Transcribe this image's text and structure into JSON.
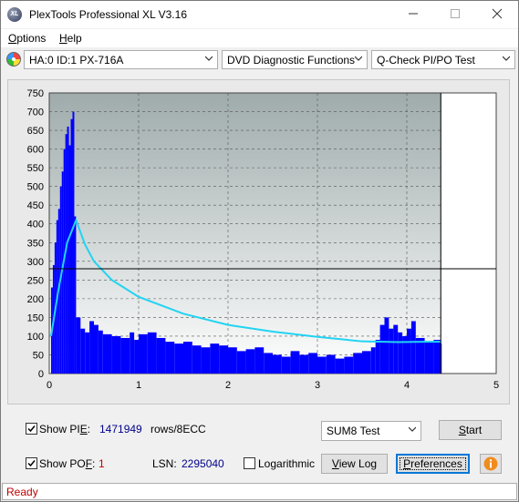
{
  "window": {
    "title": "PlexTools Professional XL V3.16",
    "app_icon": "XL",
    "controls": [
      "minimize-icon",
      "maximize-icon",
      "close-icon"
    ]
  },
  "menu": {
    "items": [
      {
        "label": "Options",
        "accel": "O",
        "rest": "ptions"
      },
      {
        "label": "Help",
        "accel": "H",
        "rest": "elp"
      }
    ]
  },
  "toolbar": {
    "drive": "HA:0 ID:1  PX-716A",
    "function": "DVD Diagnostic Functions",
    "test": "Q-Check PI/PO Test"
  },
  "chart_data": {
    "type": "line",
    "title": "",
    "xlabel": "",
    "ylabel": "",
    "xlim": [
      0,
      5
    ],
    "ylim": [
      0,
      750
    ],
    "x_ticks": [
      "0",
      "1",
      "2",
      "3",
      "4",
      "5"
    ],
    "y_ticks": [
      "0",
      "50",
      "100",
      "150",
      "200",
      "250",
      "300",
      "350",
      "400",
      "450",
      "500",
      "550",
      "600",
      "650",
      "700",
      "750"
    ],
    "grid": true,
    "reference_line_y": 280,
    "end_marker_x": 4.38,
    "series": [
      {
        "kind": "bars",
        "color": "#0000ff",
        "x": [
          0.02,
          0.04,
          0.06,
          0.08,
          0.1,
          0.12,
          0.14,
          0.16,
          0.18,
          0.2,
          0.22,
          0.24,
          0.26,
          0.28,
          0.3,
          0.35,
          0.4,
          0.45,
          0.5,
          0.55,
          0.6,
          0.7,
          0.8,
          0.9,
          0.95,
          1.0,
          1.1,
          1.2,
          1.3,
          1.4,
          1.5,
          1.6,
          1.7,
          1.8,
          1.9,
          2.0,
          2.1,
          2.2,
          2.3,
          2.4,
          2.5,
          2.6,
          2.7,
          2.8,
          2.9,
          3.0,
          3.1,
          3.2,
          3.3,
          3.4,
          3.5,
          3.6,
          3.65,
          3.7,
          3.75,
          3.8,
          3.85,
          3.9,
          3.95,
          4.0,
          4.05,
          4.1,
          4.2,
          4.3,
          4.38
        ],
        "values": [
          230,
          290,
          350,
          410,
          440,
          500,
          540,
          600,
          640,
          660,
          610,
          680,
          700,
          420,
          150,
          120,
          110,
          140,
          130,
          115,
          105,
          100,
          95,
          110,
          90,
          105,
          110,
          95,
          85,
          80,
          85,
          75,
          70,
          80,
          75,
          70,
          60,
          65,
          70,
          55,
          50,
          45,
          60,
          50,
          55,
          45,
          50,
          40,
          45,
          55,
          60,
          70,
          90,
          130,
          150,
          120,
          130,
          110,
          100,
          120,
          140,
          95,
          85,
          90,
          80
        ]
      },
      {
        "kind": "line",
        "color": "#21d4f2",
        "x": [
          0.02,
          0.1,
          0.2,
          0.3,
          0.4,
          0.5,
          0.7,
          1.0,
          1.5,
          2.0,
          2.5,
          3.0,
          3.5,
          3.9,
          4.2,
          4.38
        ],
        "values": [
          100,
          220,
          350,
          410,
          345,
          300,
          250,
          205,
          160,
          130,
          112,
          98,
          86,
          84,
          85,
          85
        ]
      }
    ]
  },
  "controls": {
    "show_pie": {
      "checked": true,
      "label_prefix": "Show PI",
      "accel": "E",
      "suffix": ":",
      "value": "1471949",
      "unit": "rows/8ECC"
    },
    "show_pof": {
      "checked": true,
      "label_prefix": "Show PO",
      "accel": "F",
      "suffix": ":",
      "value": "1"
    },
    "lsn": {
      "label": "LSN:",
      "value": "2295040"
    },
    "logarithmic": {
      "checked": false,
      "label": "Logarithmic"
    },
    "sum8": {
      "value": "SUM8 Test"
    },
    "start": {
      "accel": "S",
      "rest": "tart"
    },
    "view_log": {
      "accel": "V",
      "rest": "iew Log"
    },
    "preferences": {
      "accel": "P",
      "rest": "references"
    },
    "info_icon": "info-icon"
  },
  "status": {
    "text": "Ready"
  }
}
